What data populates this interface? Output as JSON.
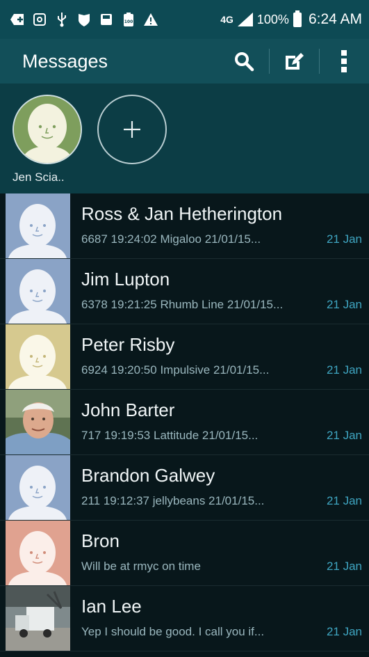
{
  "status_bar": {
    "network": "4G",
    "battery": "100%",
    "time": "6:24 AM",
    "icons": [
      "add-box-icon",
      "voicemail-icon",
      "usb-icon",
      "shield-icon",
      "save-icon",
      "battery-100-icon",
      "warning-icon"
    ]
  },
  "app_bar": {
    "title": "Messages",
    "actions": [
      "search-icon",
      "compose-icon",
      "more-options-icon"
    ]
  },
  "favorites": [
    {
      "name": "Jen Scia..",
      "avatar_color": "#7e9e5d"
    }
  ],
  "conversations": [
    {
      "name": "Ross & Jan Hetherington",
      "preview": "6687 19:24:02 Migaloo 21/01/15...",
      "date": "21 Jan",
      "avatar": "default",
      "avatar_color": "#8aa3c6"
    },
    {
      "name": "Jim Lupton",
      "preview": "6378 19:21:25 Rhumb Line 21/01/15...",
      "date": "21 Jan",
      "avatar": "default",
      "avatar_color": "#8aa3c6"
    },
    {
      "name": "Peter Risby",
      "preview": "6924 19:20:50 Impulsive 21/01/15...",
      "date": "21 Jan",
      "avatar": "default",
      "avatar_color": "#d6c98f"
    },
    {
      "name": "John Barter",
      "preview": "717 19:19:53 Lattitude 21/01/15...",
      "date": "21 Jan",
      "avatar": "photo",
      "avatar_color": "#6c7f5c"
    },
    {
      "name": "Brandon Galwey",
      "preview": "211 19:12:37 jellybeans 21/01/15...",
      "date": "21 Jan",
      "avatar": "default",
      "avatar_color": "#8aa3c6"
    },
    {
      "name": "Bron",
      "preview": "Will be at rmyc on time",
      "date": "21 Jan",
      "avatar": "default",
      "avatar_color": "#e0a290"
    },
    {
      "name": "Ian Lee",
      "preview": "Yep I should be good. I call you if...",
      "date": "21 Jan",
      "avatar": "photo",
      "avatar_color": "#8d8f87"
    }
  ]
}
